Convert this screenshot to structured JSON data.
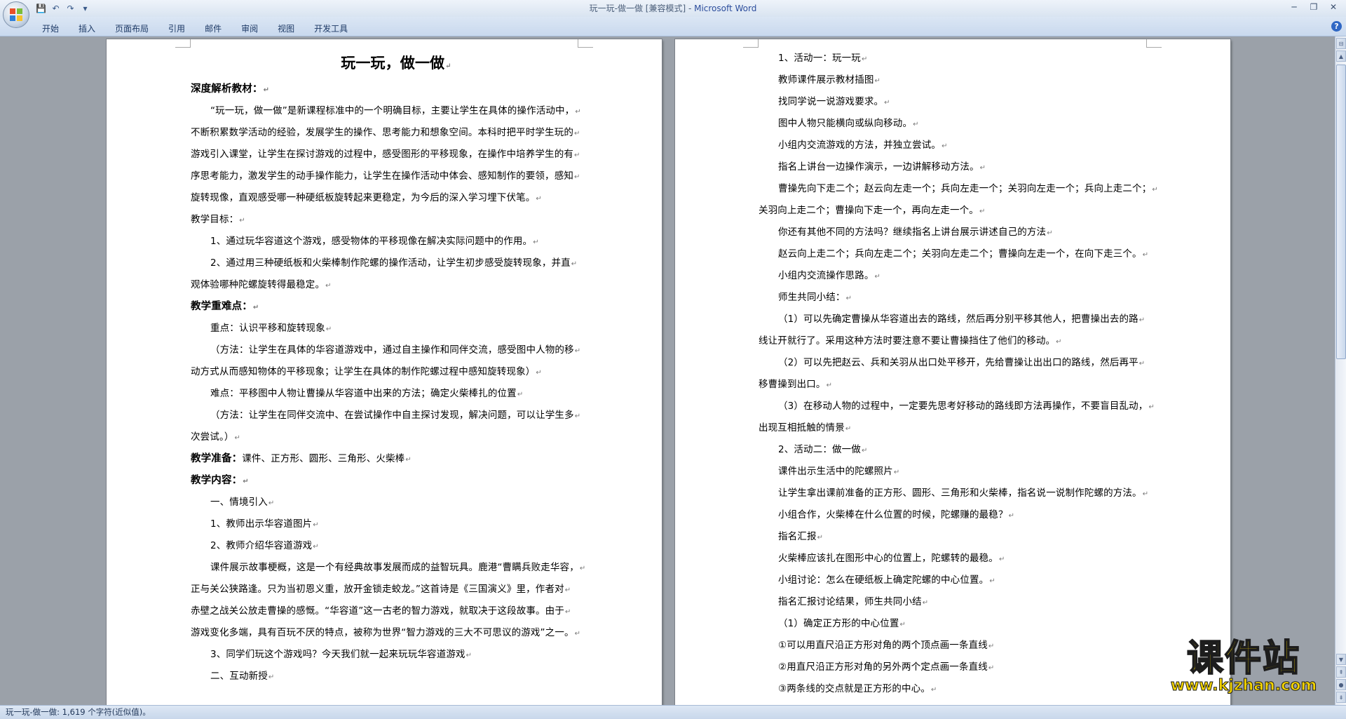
{
  "window": {
    "title": "玩一玩-做一做 [兼容模式] - ",
    "app_name": "Microsoft Word"
  },
  "quick_access": [
    {
      "name": "save-icon",
      "glyph": "💾"
    },
    {
      "name": "undo-icon",
      "glyph": "↶"
    },
    {
      "name": "redo-icon",
      "glyph": "↷"
    },
    {
      "name": "customize-icon",
      "glyph": "▾"
    }
  ],
  "window_controls": [
    {
      "name": "minimize-icon",
      "glyph": "─"
    },
    {
      "name": "restore-icon",
      "glyph": "❐"
    },
    {
      "name": "close-icon",
      "glyph": "✕"
    }
  ],
  "ribbon": {
    "tabs": [
      "开始",
      "插入",
      "页面布局",
      "引用",
      "邮件",
      "审阅",
      "视图",
      "开发工具"
    ],
    "help_glyph": "?"
  },
  "document": {
    "left_page": [
      {
        "style": "title",
        "text": "玩一玩，做一做"
      },
      {
        "style": "bold",
        "text": "深度解析教材："
      },
      {
        "style": "indent",
        "text": "“玩一玩，做一做”是新课程标准中的一个明确目标，主要让学生在具体的操作活动中，"
      },
      {
        "style": "plain",
        "text": "不断积累数学活动的经验，发展学生的操作、思考能力和想象空间。本科时把平时学生玩的"
      },
      {
        "style": "plain",
        "text": "游戏引入课堂，让学生在探讨游戏的过程中，感受图形的平移现象，在操作中培养学生的有"
      },
      {
        "style": "plain",
        "text": "序思考能力，激发学生的动手操作能力，让学生在操作活动中体会、感知制作的要领，感知"
      },
      {
        "style": "plain",
        "text": "旋转现像，直观感受哪一种硬纸板旋转起来更稳定，为今后的深入学习埋下伏笔。"
      },
      {
        "style": "plain",
        "text": "教学目标："
      },
      {
        "style": "indent",
        "text": "1、通过玩华容道这个游戏，感受物体的平移现像在解决实际问题中的作用。"
      },
      {
        "style": "indent",
        "text": "2、通过用三种硬纸板和火柴棒制作陀螺的操作活动，让学生初步感受旋转现象，并直"
      },
      {
        "style": "plain",
        "text": "观体验哪种陀螺旋转得最稳定。"
      },
      {
        "style": "bold",
        "text": "教学重难点："
      },
      {
        "style": "indent",
        "text": "重点：认识平移和旋转现象"
      },
      {
        "style": "indent",
        "text": "（方法：让学生在具体的华容道游戏中，通过自主操作和同伴交流，感受图中人物的移"
      },
      {
        "style": "plain",
        "text": "动方式从而感知物体的平移现象；让学生在具体的制作陀螺过程中感知旋转现象）"
      },
      {
        "style": "indent",
        "text": "难点：平移图中人物让曹操从华容道中出来的方法；确定火柴棒扎的位置"
      },
      {
        "style": "indent",
        "text": "（方法：让学生在同伴交流中、在尝试操作中自主探讨发现，解决问题，可以让学生多"
      },
      {
        "style": "plain",
        "text": "次尝试。）"
      },
      {
        "style": "prefix",
        "bold": "教学准备：",
        "text": "课件、正方形、圆形、三角形、火柴棒"
      },
      {
        "style": "bold",
        "text": "教学内容："
      },
      {
        "style": "indent",
        "text": "一、情境引入"
      },
      {
        "style": "indent",
        "text": "1、教师出示华容道图片"
      },
      {
        "style": "indent",
        "text": "2、教师介绍华容道游戏"
      },
      {
        "style": "indent",
        "text": "课件展示故事梗概，这是一个有经典故事发展而成的益智玩具。鹿港“曹瞒兵败走华容，"
      },
      {
        "style": "plain",
        "text": "正与关公狭路逢。只为当初恩义重，放开金锁走蛟龙。”这首诗是《三国演义》里，作者对"
      },
      {
        "style": "plain",
        "text": "赤壁之战关公放走曹操的感慨。“华容道”这一古老的智力游戏，就取决于这段故事。由于"
      },
      {
        "style": "plain",
        "text": "游戏变化多端，具有百玩不厌的特点，被称为世界“智力游戏的三大不可思议的游戏”之一。"
      },
      {
        "style": "indent",
        "text": "3、同学们玩这个游戏吗？今天我们就一起来玩玩华容道游戏"
      },
      {
        "style": "indent",
        "text": "二、互动新授"
      }
    ],
    "right_page": [
      {
        "style": "indent",
        "text": "1、活动一：玩一玩"
      },
      {
        "style": "indent",
        "text": "教师课件展示教材插图"
      },
      {
        "style": "indent",
        "text": "找同学说一说游戏要求。"
      },
      {
        "style": "indent",
        "text": "图中人物只能横向或纵向移动。"
      },
      {
        "style": "indent",
        "text": "小组内交流游戏的方法，并独立尝试。"
      },
      {
        "style": "indent",
        "text": "指名上讲台一边操作演示，一边讲解移动方法。"
      },
      {
        "style": "indent",
        "text": "曹操先向下走二个；赵云向左走一个；兵向左走一个；关羽向左走一个；兵向上走二个；"
      },
      {
        "style": "plain",
        "text": "关羽向上走二个；曹操向下走一个，再向左走一个。"
      },
      {
        "style": "indent",
        "text": "你还有其他不同的方法吗？继续指名上讲台展示讲述自己的方法"
      },
      {
        "style": "indent",
        "text": "赵云向上走二个；兵向左走二个；关羽向左走二个；曹操向左走一个，在向下走三个。"
      },
      {
        "style": "indent",
        "text": "小组内交流操作思路。"
      },
      {
        "style": "indent",
        "text": "师生共同小结："
      },
      {
        "style": "indent",
        "text": "（1）可以先确定曹操从华容道出去的路线，然后再分别平移其他人，把曹操出去的路"
      },
      {
        "style": "plain",
        "text": "线让开就行了。采用这种方法时要注意不要让曹操挡住了他们的移动。"
      },
      {
        "style": "indent",
        "text": "（2）可以先把赵云、兵和关羽从出口处平移开，先给曹操让出出口的路线，然后再平"
      },
      {
        "style": "plain",
        "text": "移曹操到出口。"
      },
      {
        "style": "indent",
        "text": "（3）在移动人物的过程中，一定要先思考好移动的路线即方法再操作，不要盲目乱动，"
      },
      {
        "style": "plain",
        "text": "出现互相抵触的情景"
      },
      {
        "style": "indent",
        "text": "2、活动二：做一做"
      },
      {
        "style": "indent",
        "text": "课件出示生活中的陀螺照片"
      },
      {
        "style": "indent",
        "text": "让学生拿出课前准备的正方形、圆形、三角形和火柴棒，指名说一说制作陀螺的方法。"
      },
      {
        "style": "indent",
        "text": "小组合作，火柴棒在什么位置的时候，陀螺赚的最稳？"
      },
      {
        "style": "indent",
        "text": "指名汇报"
      },
      {
        "style": "indent",
        "text": "火柴棒应该扎在图形中心的位置上，陀螺转的最稳。"
      },
      {
        "style": "indent",
        "text": "小组讨论：怎么在硬纸板上确定陀螺的中心位置。"
      },
      {
        "style": "indent",
        "text": "指名汇报讨论结果，师生共同小结"
      },
      {
        "style": "indent",
        "text": "（1）确定正方形的中心位置"
      },
      {
        "style": "indent",
        "text": "①可以用直尺沿正方形对角的两个顶点画一条直线"
      },
      {
        "style": "indent",
        "text": "②用直尺沿正方形对角的另外两个定点画一条直线"
      },
      {
        "style": "indent",
        "text": "③两条线的交点就是正方形的中心。"
      }
    ]
  },
  "status_bar": {
    "text": "玩一玩-做一做: 1,619 个字符(近似值)。"
  },
  "watermark": {
    "logo_text": "课件站",
    "url": "www.kjzhan.com",
    "colors": {
      "fill": "#f2d300",
      "stroke": "#1d1d1d"
    }
  }
}
